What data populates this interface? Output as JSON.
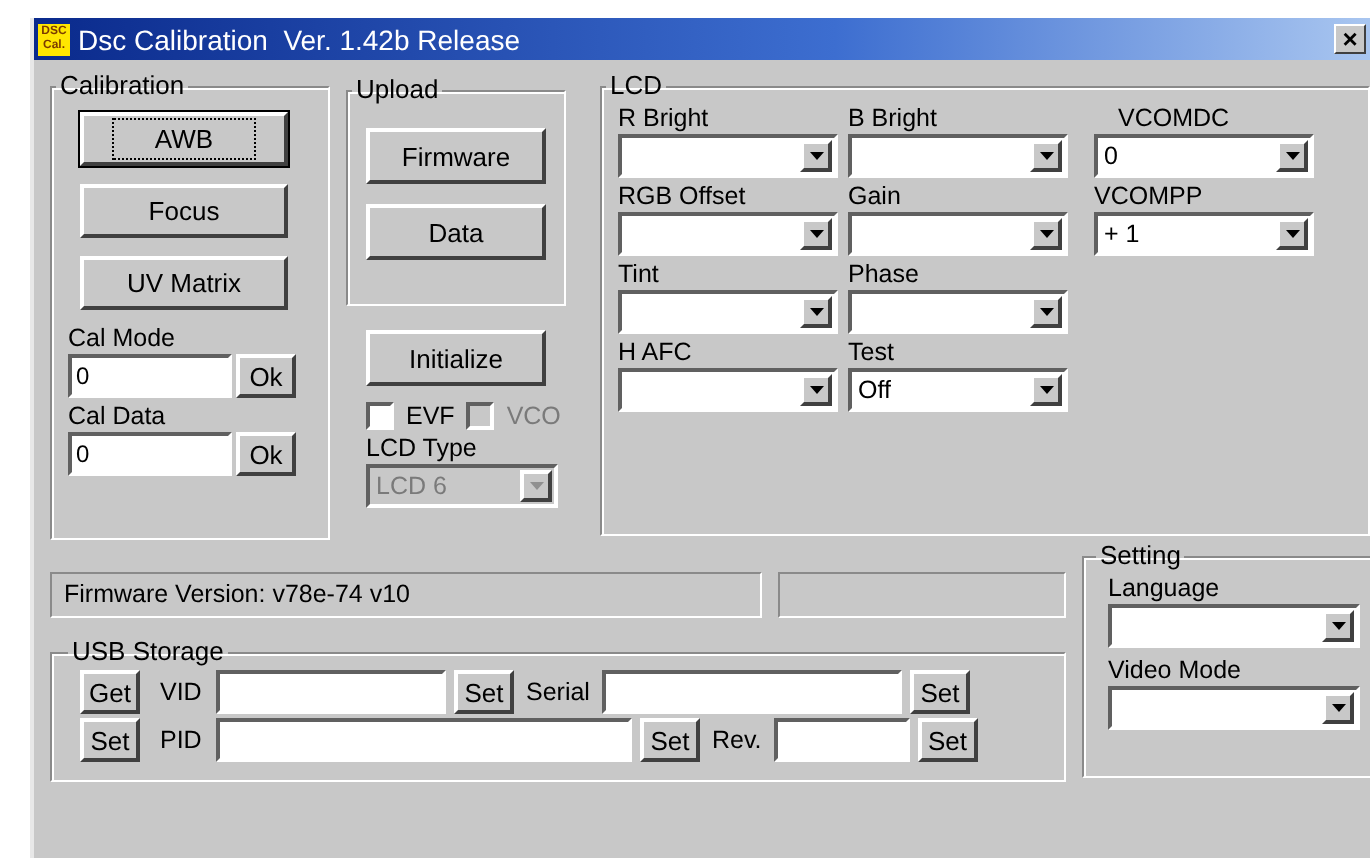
{
  "window": {
    "title": "Dsc Calibration  Ver. 1.42b Release",
    "icon_lines": [
      "DSC",
      "Cal."
    ],
    "close": "×"
  },
  "calibration": {
    "title": "Calibration",
    "buttons": [
      {
        "label": "AWB",
        "default": true
      },
      {
        "label": "Focus",
        "default": false
      },
      {
        "label": "UV Matrix",
        "default": false
      }
    ],
    "fields": [
      {
        "label": "Cal Mode",
        "value": "0",
        "button": "Ok"
      },
      {
        "label": "Cal Data",
        "value": "0",
        "button": "Ok"
      }
    ]
  },
  "upload": {
    "title": "Upload",
    "buttons": [
      "Firmware",
      "Data"
    ]
  },
  "initialize": "Initialize",
  "checkboxes": [
    {
      "label": "EVF",
      "checked": false,
      "disabled": false
    },
    {
      "label": "VCO",
      "checked": false,
      "disabled": true
    }
  ],
  "lcd_type": {
    "label": "LCD Type",
    "value": "LCD 6",
    "disabled": true
  },
  "lcd": {
    "title": "LCD",
    "columns": [
      [
        {
          "label": "R Bright"
        },
        {
          "label": "RGB Offset"
        },
        {
          "label": "Tint"
        },
        {
          "label": "H AFC"
        }
      ],
      [
        {
          "label": "B Bright"
        },
        {
          "label": "Gain"
        },
        {
          "label": "Phase"
        },
        {
          "label": "Test",
          "value": "Off"
        }
      ],
      [
        {
          "label": "VCOMDC",
          "value": "0"
        },
        {
          "label": "VCOMPP",
          "value": "+ 1"
        }
      ]
    ]
  },
  "status": {
    "firmware": "Firmware Version: v78e-74 v10"
  },
  "usb": {
    "title": "USB Storage",
    "get_button": "Get",
    "set_button": "Set",
    "fields": [
      {
        "label": "VID",
        "button": "Set"
      },
      {
        "label": "Serial",
        "button": "Set"
      },
      {
        "label": "PID",
        "button": "Set"
      },
      {
        "label": "Rev.",
        "button": "Set"
      }
    ]
  },
  "setting": {
    "title": "Setting",
    "combos": [
      {
        "label": "Language"
      },
      {
        "label": "Video Mode"
      }
    ]
  }
}
